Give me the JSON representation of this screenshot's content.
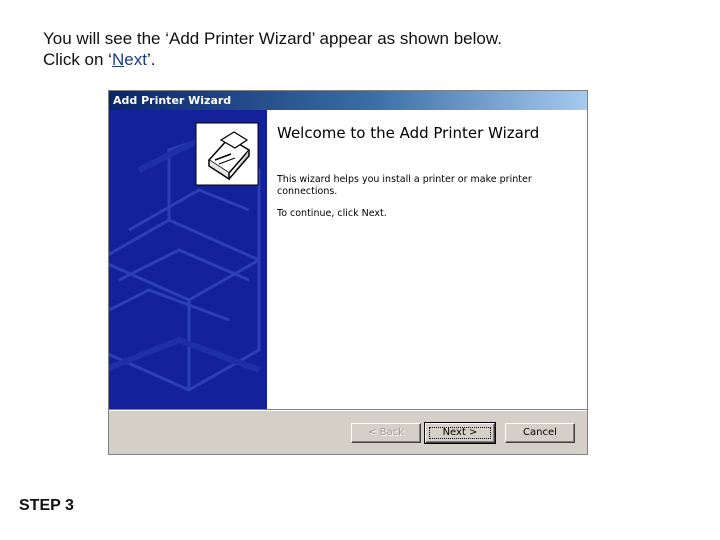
{
  "instruction": {
    "line1": "You will see the ‘Add Printer Wizard’ appear as shown below.",
    "line2_prefix": "Click on ‘",
    "line2_link_underlined": "N",
    "line2_link_rest": "ext",
    "line2_suffix": "’."
  },
  "step_label": "STEP 3",
  "window": {
    "title": "Add Printer Wizard",
    "welcome_heading": "Welcome to the Add Printer Wizard",
    "description": "This wizard helps you install a printer or make printer connections.",
    "continue_text": "To continue, click Next.",
    "buttons": {
      "back": "< Back",
      "next": "Next >",
      "cancel": "Cancel"
    }
  },
  "colors": {
    "titlebar_start": "#0a246a",
    "banner": "#13229a",
    "face": "#d4d0c8"
  },
  "icons": {
    "wizard": "printer-wizard-icon",
    "banner_art": "printer-graphic"
  }
}
